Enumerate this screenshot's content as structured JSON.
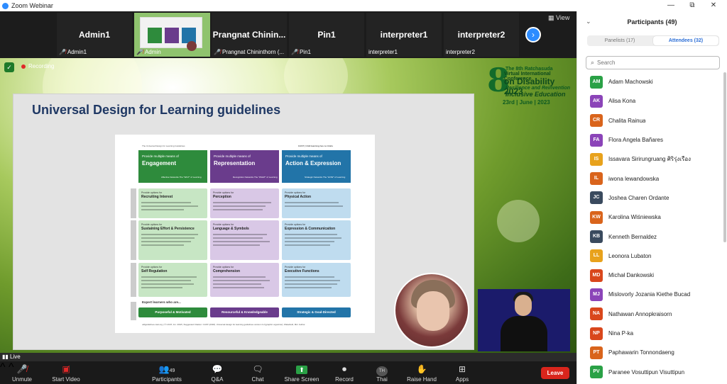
{
  "window": {
    "title": "Zoom Webinar",
    "controls": [
      "—",
      "⧉",
      "✕"
    ]
  },
  "tiles": [
    {
      "name": "Admin1",
      "label": "Admin1",
      "muted": true
    },
    {
      "name": "",
      "label": "Admin",
      "muted": true,
      "is_share": true
    },
    {
      "name": "Prangnat Chinin...",
      "label": "Prangnat Chininthorn (...",
      "muted": true
    },
    {
      "name": "Pin1",
      "label": "Pin1",
      "muted": true
    },
    {
      "name": "interpreter1",
      "label": "interpreter1",
      "muted": false
    },
    {
      "name": "interpreter2",
      "label": "interpreter2",
      "muted": false
    }
  ],
  "view_label": "View",
  "recording_label": "Recording",
  "conference": {
    "line1": "The 8th Ratchasuda",
    "line2": "Virtual International Conference",
    "line3": "on Disability 2023",
    "line4": "Resilience and Reinvention of",
    "line5": "Inclusive Education",
    "line6": "23rd | June | 2023"
  },
  "slide": {
    "title": "Universal Design for Learning guidelines",
    "doc_header": "The Universal Design for Learning Guidelines",
    "brand": "CAST | Until learning has no limits",
    "columns": [
      {
        "prefix": "Provide multiple means of",
        "name": "Engagement",
        "network": "Affective Networks The \"WHY\" of Learning",
        "color": "#2e8b3c",
        "rows": [
          {
            "title": "Provide options for",
            "heading": "Recruiting Interest"
          },
          {
            "title": "Provide options for",
            "heading": "Sustaining Effort & Persistence"
          },
          {
            "title": "Provide options for",
            "heading": "Self Regulation"
          }
        ],
        "footer": "Purposeful & Motivated"
      },
      {
        "prefix": "Provide multiple means of",
        "name": "Representation",
        "network": "Recognition Networks The \"WHAT\" of Learning",
        "color": "#6a3c8c",
        "rows": [
          {
            "title": "Provide options for",
            "heading": "Perception"
          },
          {
            "title": "Provide options for",
            "heading": "Language & Symbols"
          },
          {
            "title": "Provide options for",
            "heading": "Comprehension"
          }
        ],
        "footer": "Resourceful & Knowledgeable"
      },
      {
        "prefix": "Provide multiple means of",
        "name": "Action & Expression",
        "network": "Strategic Networks The \"HOW\" of Learning",
        "color": "#2274a8",
        "rows": [
          {
            "title": "Provide options for",
            "heading": "Physical Action"
          },
          {
            "title": "Provide options for",
            "heading": "Expression & Communication"
          },
          {
            "title": "Provide options for",
            "heading": "Executive Functions"
          }
        ],
        "footer": "Strategic & Goal-Directed"
      }
    ],
    "row_labels": [
      "Access",
      "Build",
      "Internalize",
      "Goal"
    ],
    "expert_label": "Expert learners who are...",
    "footnote": "udlguidelines.cast.org | © CAST, Inc. 2018 | Suggested Citation: CAST (2018). Universal design for learning guidelines version 2.2 [graphic organizer]. Wakefield, MA: Author."
  },
  "live_label": "Live",
  "toolbar": {
    "unmute": "Unmute",
    "stop_video": "Start Video",
    "participants": "Participants",
    "participants_count": "49",
    "qa": "Q&A",
    "chat": "Chat",
    "share": "Share Screen",
    "record": "Record",
    "language": "Thai",
    "language_badge": "TH",
    "raise_hand": "Raise Hand",
    "apps": "Apps",
    "leave": "Leave"
  },
  "panel": {
    "title": "Participants (49)",
    "tabs": [
      "Panelists (17)",
      "Attendees (32)"
    ],
    "active_tab": 1,
    "search_placeholder": "Search",
    "attendees": [
      {
        "initials": "AM",
        "name": "Adam Machowski",
        "color": "#2aa146"
      },
      {
        "initials": "AK",
        "name": "Alisa Kona",
        "color": "#8b44b8"
      },
      {
        "initials": "CR",
        "name": "Chalita Rainua",
        "color": "#d9641c"
      },
      {
        "initials": "FA",
        "name": "Flora Angela Bañares",
        "color": "#8b44b8"
      },
      {
        "initials": "IS",
        "name": "Issavara Sirirungruang ศิริรุ่งเรือง",
        "color": "#e8a21c"
      },
      {
        "initials": "IL",
        "name": "iwona lewandowska",
        "color": "#d9641c"
      },
      {
        "initials": "JC",
        "name": "Joshea Charen Ordante",
        "color": "#3a4a5e"
      },
      {
        "initials": "KW",
        "name": "Karolina Wiśniewska",
        "color": "#d9641c"
      },
      {
        "initials": "KB",
        "name": "Kenneth Bernaldez",
        "color": "#3a4a5e"
      },
      {
        "initials": "LL",
        "name": "Leonora Lubaton",
        "color": "#e8a21c"
      },
      {
        "initials": "MD",
        "name": "Michał Dankowski",
        "color": "#d9471c"
      },
      {
        "initials": "MJ",
        "name": "Mislovorly Jozania Kiethe Bucad",
        "color": "#8b44b8"
      },
      {
        "initials": "NA",
        "name": "Nathawan Annopkraisorn",
        "color": "#d9471c"
      },
      {
        "initials": "NP",
        "name": "Nina P-ka",
        "color": "#d9471c"
      },
      {
        "initials": "PT",
        "name": "Paphawarin Tonnondaeng",
        "color": "#d9641c"
      },
      {
        "initials": "PV",
        "name": "Paranee Vosuttipun Visuttipun",
        "color": "#2aa146"
      }
    ]
  }
}
